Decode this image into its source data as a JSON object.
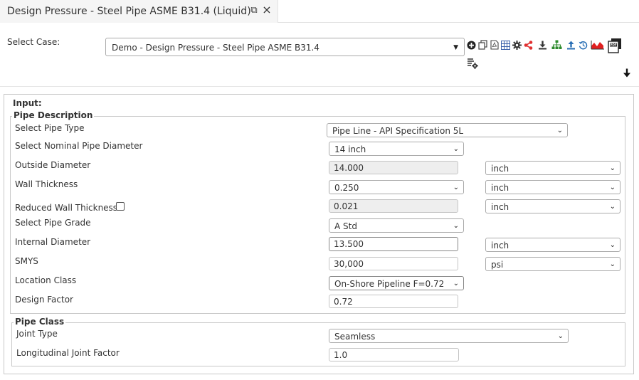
{
  "tab": {
    "title": "Design Pressure - Steel Pipe ASME B31.4 (Liquid)",
    "popout_icon": "⧉",
    "close_icon": "×"
  },
  "header": {
    "case_label": "Select Case:",
    "case_value": "Demo - Design Pressure - Steel Pipe ASME B31.4",
    "arrow": "▼",
    "toolbar": [
      {
        "name": "add-icon",
        "color": "#222222"
      },
      {
        "name": "copy-icon",
        "color": "#444444"
      },
      {
        "name": "pdf-file-icon",
        "color": "#444444"
      },
      {
        "name": "table-icon",
        "color": "#3a5fa8"
      },
      {
        "name": "gear-icon",
        "color": "#333333"
      },
      {
        "name": "share-icon",
        "color": "#e03030"
      },
      {
        "name": "download-icon",
        "color": "#333333"
      },
      {
        "name": "hierarchy-icon",
        "color": "#2e8b2e"
      },
      {
        "name": "upload-icon",
        "color": "#2a6fb5"
      },
      {
        "name": "history-icon",
        "color": "#2a6fb5"
      },
      {
        "name": "area-chart-icon",
        "color": "#e02020"
      },
      {
        "name": "pdf-export-icon",
        "color": "#222222"
      }
    ],
    "settings_icon_name": "document-settings-icon",
    "scroll_down_icon_name": "arrow-down-icon"
  },
  "form": {
    "input_legend": "Input:",
    "pipe_description": {
      "legend": "Pipe Description",
      "pipe_type_label": "Select Pipe Type",
      "pipe_type_value": "Pipe Line - API Specification 5L",
      "nominal_diameter_label": "Select Nominal Pipe Diameter",
      "nominal_diameter_value": "14 inch",
      "outside_diameter_label": "Outside Diameter",
      "outside_diameter_value": "14.000",
      "outside_diameter_unit": "inch",
      "wall_thickness_label": "Wall Thickness",
      "wall_thickness_value": "0.250",
      "wall_thickness_unit": "inch",
      "reduced_wall_label": "Reduced Wall Thickness",
      "reduced_wall_value": "0.021",
      "reduced_wall_unit": "inch",
      "pipe_grade_label": "Select Pipe Grade",
      "pipe_grade_value": "A Std",
      "internal_diameter_label": "Internal Diameter",
      "internal_diameter_value": "13.500",
      "internal_diameter_unit": "inch",
      "smys_label": "SMYS",
      "smys_value": "30,000",
      "smys_unit": "psi",
      "location_class_label": "Location Class",
      "location_class_value": "On-Shore Pipeline F=0.72",
      "design_factor_label": "Design Factor",
      "design_factor_value": "0.72"
    },
    "pipe_class": {
      "legend": "Pipe Class",
      "joint_type_label": "Joint Type",
      "joint_type_value": "Seamless",
      "joint_factor_label": "Longitudinal Joint Factor",
      "joint_factor_value": "1.0"
    }
  }
}
